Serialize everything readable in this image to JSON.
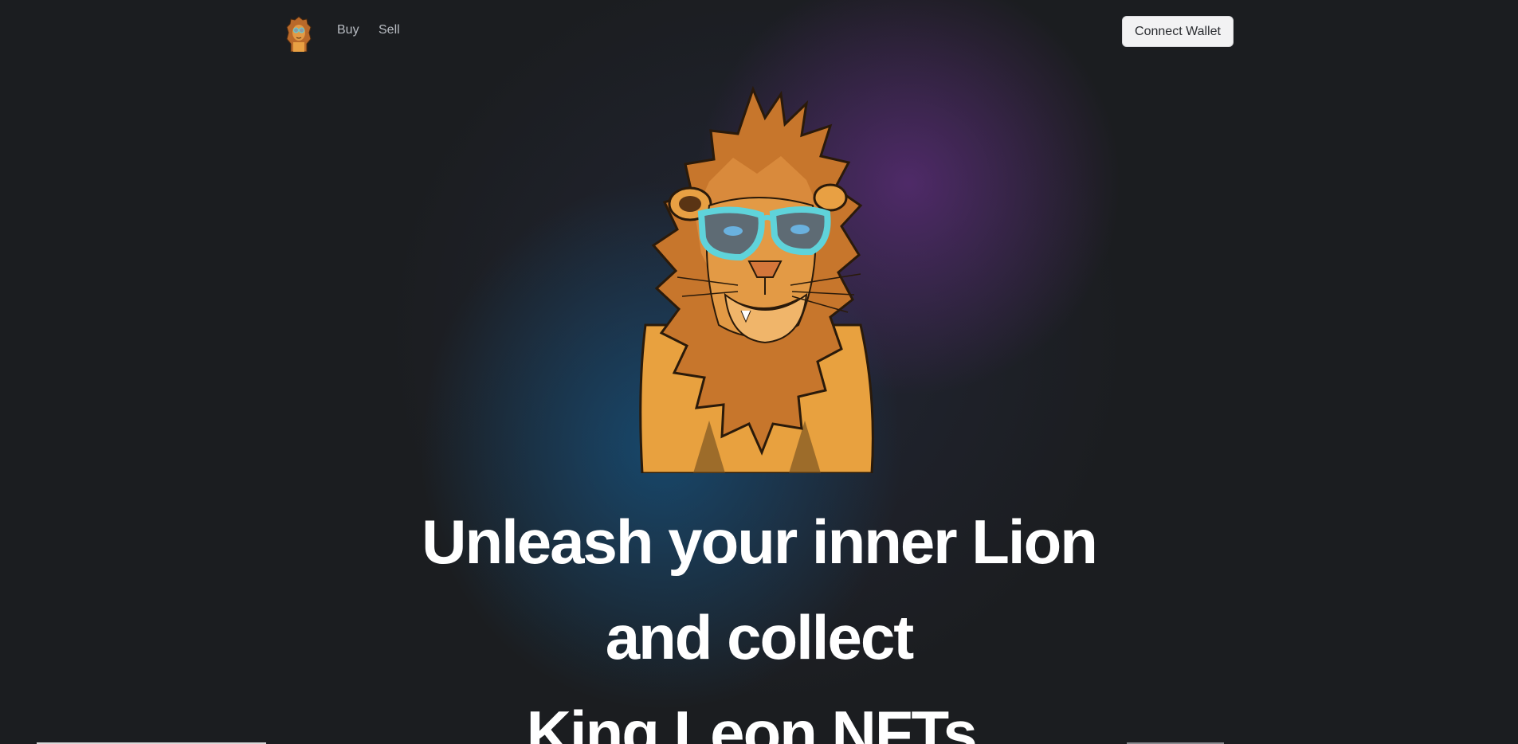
{
  "nav": {
    "logo_icon": "lion-logo-icon",
    "links": [
      {
        "label": "Buy"
      },
      {
        "label": "Sell"
      }
    ],
    "connect_wallet_label": "Connect Wallet"
  },
  "hero": {
    "image_icon": "lion-with-sunglasses-illustration",
    "headline_lines": [
      "Unleash your inner Lion",
      "and collect",
      "King Leon NFTs."
    ]
  },
  "colors": {
    "background": "#1b1d20",
    "glow_purple": "#5f2d7d",
    "glow_blue": "#164e76",
    "button_bg": "#f2f2f3",
    "text_primary": "#ffffff",
    "nav_text": "#b8bcc2"
  }
}
